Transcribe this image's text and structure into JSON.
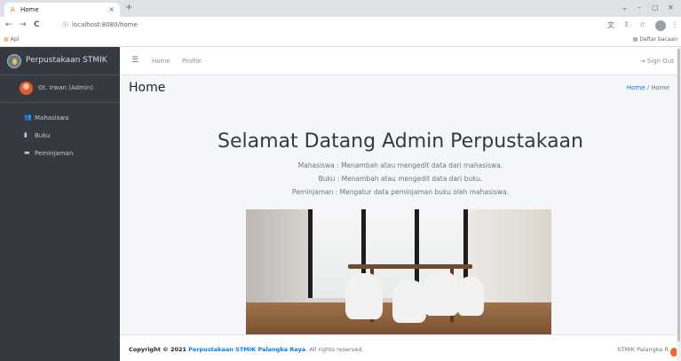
{
  "browser": {
    "tab_title": "Home",
    "favicon": "A",
    "tab_close": "×",
    "new_tab": "+",
    "back": "←",
    "forward": "→",
    "reload": "C",
    "url": "localhost:8080/home",
    "window_controls": [
      "⌄",
      "–",
      "▢",
      "✕"
    ],
    "right_icons": [
      "translate-icon",
      "share-icon",
      "star-icon",
      "profile-icon",
      "menu-icon"
    ],
    "bookmarks": {
      "apps_label": "Apl",
      "reading_list": "Daftar bacaan"
    }
  },
  "sidebar": {
    "brand": "Perpustakaan STMIK",
    "user": "Gt. Irwan (Admin)",
    "items": [
      {
        "label": "Mahasiswa",
        "icon": "users-icon"
      },
      {
        "label": "Buku",
        "icon": "book-icon"
      },
      {
        "label": "Peminjaman",
        "icon": "folder-icon"
      }
    ]
  },
  "navbar": {
    "links": [
      "Home",
      "Profile"
    ],
    "signout": "Sign Out"
  },
  "page": {
    "title": "Home",
    "breadcrumb": {
      "link": "Home",
      "separator": "/",
      "current": "Home"
    },
    "welcome": "Selamat Datang Admin Perpustakaan",
    "descriptions": [
      "Mahasiswa : Menambah atau mengedit data dari mahasiswa.",
      "Buku : Menambah atau mengedit data dari buku.",
      "Peminjaman : Mengatur data peminjaman buku oleh mahasiswa."
    ]
  },
  "footer": {
    "prefix": "Copyright © 2021",
    "org": "Perpustakaan STMIK Palangka Raya",
    "suffix": ". All rights reserved.",
    "right": "STMIK Palangka R"
  },
  "colors": {
    "sidebar": "#343a40",
    "link": "#007bff",
    "content_bg": "#f4f6f9"
  }
}
